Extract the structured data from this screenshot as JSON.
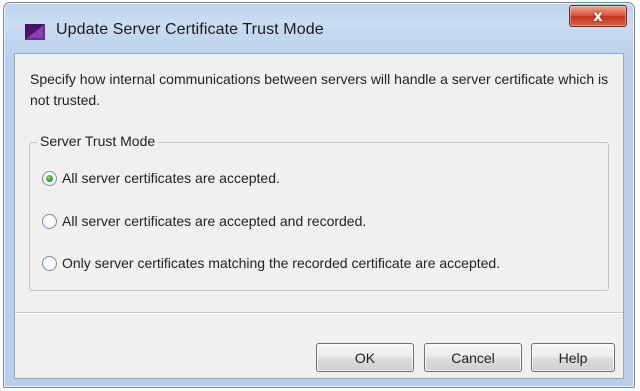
{
  "window": {
    "title": "Update Server Certificate Trust Mode",
    "close_label": "x",
    "app_icon": "purple-flag-icon"
  },
  "dialog": {
    "description": "Specify how internal communications between servers will handle a server certificate which is not trusted.",
    "group_label": "Server Trust Mode",
    "options": [
      {
        "label": "All server certificates are accepted.",
        "selected": true
      },
      {
        "label": "All server certificates are accepted and recorded.",
        "selected": false
      },
      {
        "label": "Only server certificates matching the recorded certificate are accepted.",
        "selected": false
      }
    ]
  },
  "buttons": {
    "ok": "OK",
    "cancel": "Cancel",
    "help": "Help"
  },
  "colors": {
    "title_bar": "#bcd3ee",
    "client_bg": "#f1f0ee",
    "close_button": "#d9543c",
    "radio_selected": "#2e8f25"
  }
}
